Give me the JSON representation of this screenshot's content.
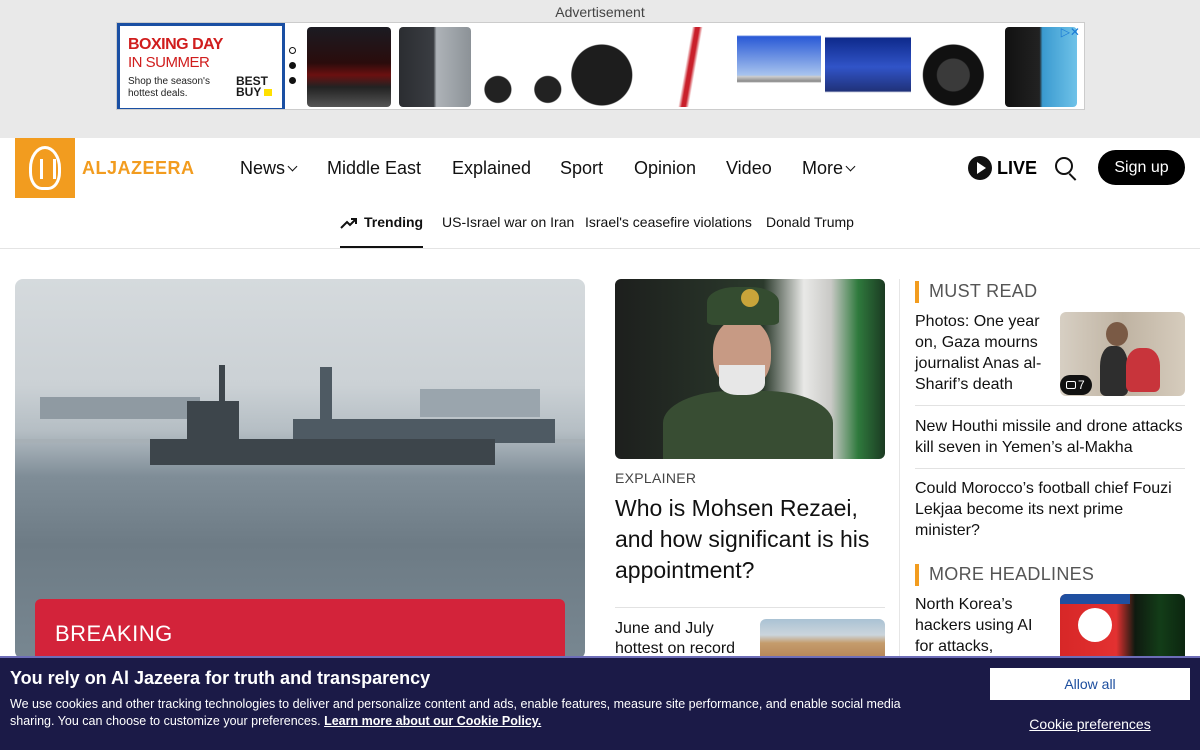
{
  "ad": {
    "label": "Advertisement",
    "promo_line1": "BOXING DAY",
    "promo_line2": "IN SUMMER",
    "promo_text": "Shop the season's hottest deals.",
    "brand": "BEST BUY",
    "products": [
      "gaming laptop",
      "smartphone",
      "electric bike",
      "robot vacuum",
      "stick vacuum",
      "laptop",
      "smart TV",
      "DSLR camera",
      "smartphone"
    ]
  },
  "header": {
    "logo_text": "ALJAZEERA",
    "nav": [
      {
        "label": "News",
        "dropdown": true
      },
      {
        "label": "Middle East",
        "dropdown": false
      },
      {
        "label": "Explained",
        "dropdown": false
      },
      {
        "label": "Sport",
        "dropdown": false
      },
      {
        "label": "Opinion",
        "dropdown": false
      },
      {
        "label": "Video",
        "dropdown": false
      },
      {
        "label": "More",
        "dropdown": true
      }
    ],
    "live_label": "LIVE",
    "signup_label": "Sign up",
    "trending": {
      "label": "Trending",
      "items": [
        "US-Israel war on Iran",
        "Israel's ceasefire violations",
        "Donald Trump"
      ]
    }
  },
  "hero": {
    "badge": "BREAKING"
  },
  "middle": {
    "category": "EXPLAINER",
    "headline": "Who is Mohsen Rezaei, and how significant is his appointment?",
    "secondary_headline": "June and July hottest on record"
  },
  "right": {
    "must_read_title": "MUST READ",
    "must_read": [
      {
        "headline": "Photos: One year on, Gaza mourns journalist Anas al-Sharif’s death",
        "photo_count": "7"
      },
      {
        "headline": "New Houthi missile and drone attacks kill seven in Yemen’s al-Makha"
      },
      {
        "headline": "Could Morocco’s football chief Fouzi Lekjaa become its next prime minister?"
      }
    ],
    "more_headlines_title": "MORE HEADLINES",
    "more_headlines": [
      {
        "headline": "North Korea’s hackers using AI for attacks,"
      }
    ]
  },
  "cookie": {
    "title": "You rely on Al Jazeera for truth and transparency",
    "body": "We use cookies and other tracking technologies to deliver and personalize content and ads, enable features, measure site performance, and enable social media sharing. You can choose to customize your preferences.",
    "link": "Learn more about our Cookie Policy.",
    "allow_all": "Allow all",
    "preferences": "Cookie preferences"
  },
  "colors": {
    "brand_orange": "#f29c1f",
    "breaking_red": "#d3233a",
    "cookie_bg": "#1b1a47"
  }
}
